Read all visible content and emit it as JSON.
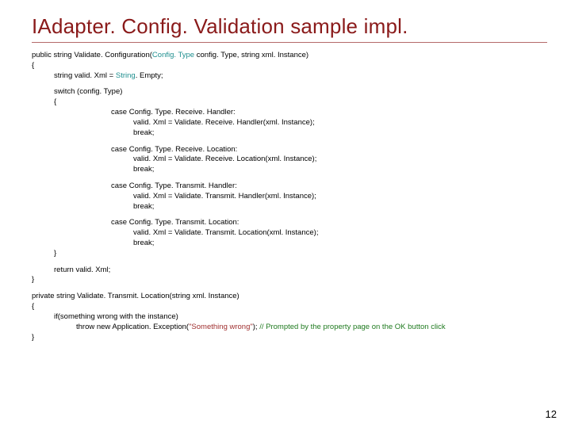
{
  "title": "IAdapter. Config. Validation sample impl.",
  "code": {
    "sig_pre": "public string Validate. Configuration(",
    "sig_type": "Config. Type",
    "sig_post": " config. Type, string xml. Instance)",
    "lbrace": "{",
    "line_empty_pre": "string valid. Xml = ",
    "line_empty_type": "String",
    "line_empty_post": ". Empty;",
    "switch": "switch (config. Type)",
    "switch_lbrace": "{",
    "case1": "case Config. Type. Receive. Handler:",
    "case1_body": "valid. Xml = Validate. Receive. Handler(xml. Instance);",
    "break": "break;",
    "case2": "case Config. Type. Receive. Location:",
    "case2_body": "valid. Xml = Validate. Receive. Location(xml. Instance);",
    "case3": "case Config. Type. Transmit. Handler:",
    "case3_body": "valid. Xml = Validate. Transmit. Handler(xml. Instance);",
    "case4": "case Config. Type. Transmit. Location:",
    "case4_body": "valid. Xml = Validate. Transmit. Location(xml. Instance);",
    "switch_rbrace": "}",
    "return": "return valid. Xml;",
    "rbrace": "}",
    "priv_sig": "private string Validate. Transmit. Location(string xml. Instance)",
    "if_line": "if(something wrong with the instance)",
    "throw_pre": "throw new Application. Exception(",
    "throw_str": "\"Something wrong\"",
    "throw_post": "); ",
    "throw_cmt": "// Prompted by the property page on the OK button click"
  },
  "pagenum": "12"
}
